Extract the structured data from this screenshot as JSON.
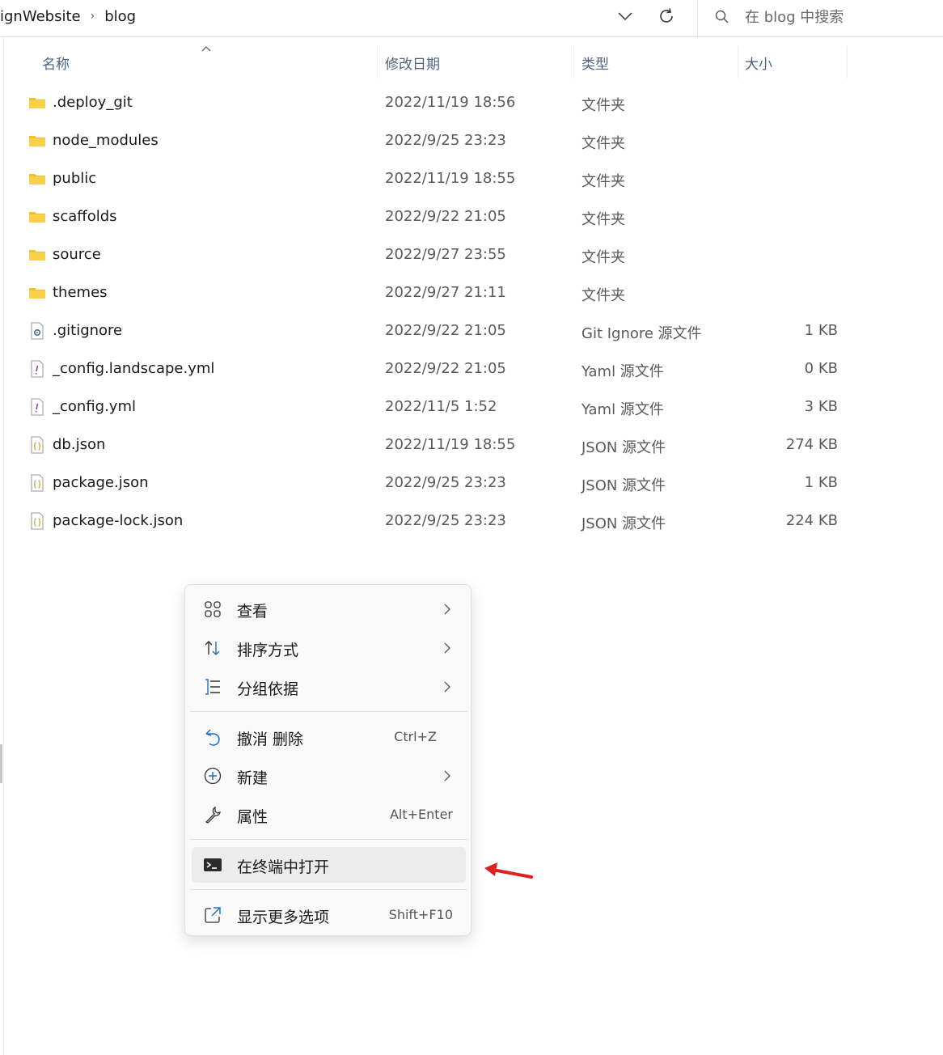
{
  "breadcrumb": {
    "parent": "ignWebsite",
    "separator": "›",
    "current": "blog"
  },
  "search": {
    "placeholder": "在 blog 中搜索"
  },
  "columns": {
    "name": "名称",
    "date": "修改日期",
    "type": "类型",
    "size": "大小"
  },
  "files": [
    {
      "name": ".deploy_git",
      "date": "2022/11/19 18:56",
      "type": "文件夹",
      "size": "",
      "icon": "folder-icon"
    },
    {
      "name": "node_modules",
      "date": "2022/9/25 23:23",
      "type": "文件夹",
      "size": "",
      "icon": "folder-icon"
    },
    {
      "name": "public",
      "date": "2022/11/19 18:55",
      "type": "文件夹",
      "size": "",
      "icon": "folder-icon"
    },
    {
      "name": "scaffolds",
      "date": "2022/9/22 21:05",
      "type": "文件夹",
      "size": "",
      "icon": "folder-icon"
    },
    {
      "name": "source",
      "date": "2022/9/27 23:55",
      "type": "文件夹",
      "size": "",
      "icon": "folder-icon"
    },
    {
      "name": "themes",
      "date": "2022/9/27 21:11",
      "type": "文件夹",
      "size": "",
      "icon": "folder-icon"
    },
    {
      "name": ".gitignore",
      "date": "2022/9/22 21:05",
      "type": "Git Ignore 源文件",
      "size": "1 KB",
      "icon": "gear-file-icon"
    },
    {
      "name": "_config.landscape.yml",
      "date": "2022/9/22 21:05",
      "type": "Yaml 源文件",
      "size": "0 KB",
      "icon": "yaml-file-icon"
    },
    {
      "name": "_config.yml",
      "date": "2022/11/5 1:52",
      "type": "Yaml 源文件",
      "size": "3 KB",
      "icon": "yaml-file-icon"
    },
    {
      "name": "db.json",
      "date": "2022/11/19 18:55",
      "type": "JSON 源文件",
      "size": "274 KB",
      "icon": "json-file-icon"
    },
    {
      "name": "package.json",
      "date": "2022/9/25 23:23",
      "type": "JSON 源文件",
      "size": "1 KB",
      "icon": "json-file-icon"
    },
    {
      "name": "package-lock.json",
      "date": "2022/9/25 23:23",
      "type": "JSON 源文件",
      "size": "224 KB",
      "icon": "json-file-icon"
    }
  ],
  "context_menu": {
    "view": {
      "label": "查看"
    },
    "sort": {
      "label": "排序方式"
    },
    "group": {
      "label": "分组依据"
    },
    "undo": {
      "label": "撤消 删除",
      "shortcut": "Ctrl+Z"
    },
    "new": {
      "label": "新建"
    },
    "properties": {
      "label": "属性",
      "shortcut": "Alt+Enter"
    },
    "terminal": {
      "label": "在终端中打开"
    },
    "more": {
      "label": "显示更多选项",
      "shortcut": "Shift+F10"
    }
  },
  "colors": {
    "folder": "#f4c12e",
    "accent_blue": "#1f6fc2",
    "annotation_red": "#e02020",
    "header_text": "#4a6580"
  }
}
